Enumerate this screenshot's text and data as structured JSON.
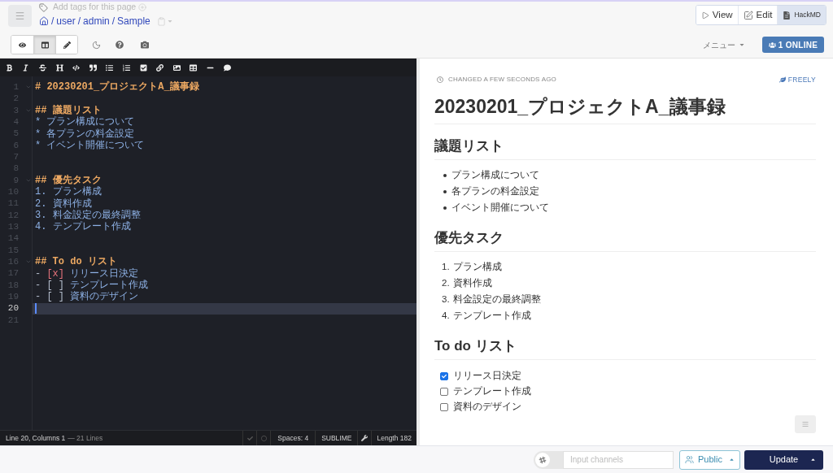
{
  "header": {
    "tags_hint": "Add tags for this page",
    "breadcrumb": [
      {
        "separator": "/",
        "label": "user"
      },
      {
        "separator": "/",
        "label": "admin"
      },
      {
        "separator": "/",
        "label": "Sample"
      }
    ],
    "mode_buttons": [
      {
        "kind": "view",
        "label": "View",
        "selected": false
      },
      {
        "kind": "edit",
        "label": "Edit",
        "selected": false
      },
      {
        "kind": "hackmd",
        "label": "HackMD",
        "selected": true
      }
    ]
  },
  "toolbar": {
    "view_modes": [
      {
        "kind": "view",
        "selected": false
      },
      {
        "kind": "both",
        "selected": true
      },
      {
        "kind": "edit",
        "selected": false
      }
    ],
    "menu": "メニュー",
    "online": "1 ONLINE"
  },
  "editor": {
    "lines": [
      {
        "number": "1",
        "kind": "heading",
        "active": false,
        "mark": "#",
        "text": "20230201_プロジェクトA_議事録"
      },
      {
        "number": "2",
        "kind": "blank",
        "active": false
      },
      {
        "number": "3",
        "kind": "heading",
        "active": false,
        "mark": "##",
        "text": "議題リスト"
      },
      {
        "number": "4",
        "kind": "bullet",
        "active": false,
        "mark": "*",
        "text": "プラン構成について"
      },
      {
        "number": "5",
        "kind": "bullet",
        "active": false,
        "mark": "*",
        "text": "各プランの料金設定"
      },
      {
        "number": "6",
        "kind": "bullet",
        "active": false,
        "mark": "*",
        "text": "イベント開催について"
      },
      {
        "number": "7",
        "kind": "blank",
        "active": false
      },
      {
        "number": "8",
        "kind": "blank",
        "active": false
      },
      {
        "number": "9",
        "kind": "heading",
        "active": false,
        "mark": "##",
        "text": "優先タスク"
      },
      {
        "number": "10",
        "kind": "ordered",
        "active": false,
        "mark": "1.",
        "text": "プラン構成"
      },
      {
        "number": "11",
        "kind": "ordered",
        "active": false,
        "mark": "2.",
        "text": "資料作成"
      },
      {
        "number": "12",
        "kind": "ordered",
        "active": false,
        "mark": "3.",
        "text": "料金設定の最終調整"
      },
      {
        "number": "13",
        "kind": "ordered",
        "active": false,
        "mark": "4.",
        "text": "テンプレート作成"
      },
      {
        "number": "14",
        "kind": "blank",
        "active": false
      },
      {
        "number": "15",
        "kind": "blank",
        "active": false
      },
      {
        "number": "16",
        "kind": "heading",
        "active": false,
        "mark": "##",
        "text": "To do リスト"
      },
      {
        "number": "17",
        "kind": "task",
        "active": false,
        "mark": "-",
        "box": "[x]",
        "checked": true,
        "text": "リリース日決定"
      },
      {
        "number": "18",
        "kind": "task",
        "active": false,
        "mark": "-",
        "box": "[ ]",
        "checked": false,
        "text": "テンプレート作成"
      },
      {
        "number": "19",
        "kind": "task",
        "active": false,
        "mark": "-",
        "box": "[ ]",
        "checked": false,
        "text": "資料のデザイン"
      },
      {
        "number": "20",
        "kind": "blank",
        "active": true
      },
      {
        "number": "21",
        "kind": "blank",
        "active": false
      }
    ],
    "status_bar": {
      "position": "Line 20, Columns 1",
      "line_count": "— 21 Lines",
      "indent": "Spaces: 4",
      "keymap": "SUBLIME",
      "length": "Length 182"
    }
  },
  "preview": {
    "changed": "CHANGED A FEW SECONDS AGO",
    "permission": "FREELY",
    "title": "20230201_プロジェクトA_議事録",
    "sections": [
      {
        "heading": "議題リスト",
        "kind": "bullet",
        "items": [
          {
            "text": "プラン構成について"
          },
          {
            "text": "各プランの料金設定"
          },
          {
            "text": "イベント開催について"
          }
        ]
      },
      {
        "heading": "優先タスク",
        "kind": "ordered",
        "items": [
          {
            "number": "1.",
            "text": "プラン構成"
          },
          {
            "number": "2.",
            "text": "資料作成"
          },
          {
            "number": "3.",
            "text": "料金設定の最終調整"
          },
          {
            "number": "4.",
            "text": "テンプレート作成"
          }
        ]
      },
      {
        "heading": "To do リスト",
        "kind": "task",
        "items": [
          {
            "checked": true,
            "text": "リリース日決定"
          },
          {
            "checked": false,
            "text": "テンプレート作成"
          },
          {
            "checked": false,
            "text": "資料のデザイン"
          }
        ]
      }
    ]
  },
  "footer": {
    "slack_toggle": {
      "on": false
    },
    "channels": {
      "placeholder": "Input channels"
    },
    "visibility": "Public",
    "submit": "Update"
  }
}
